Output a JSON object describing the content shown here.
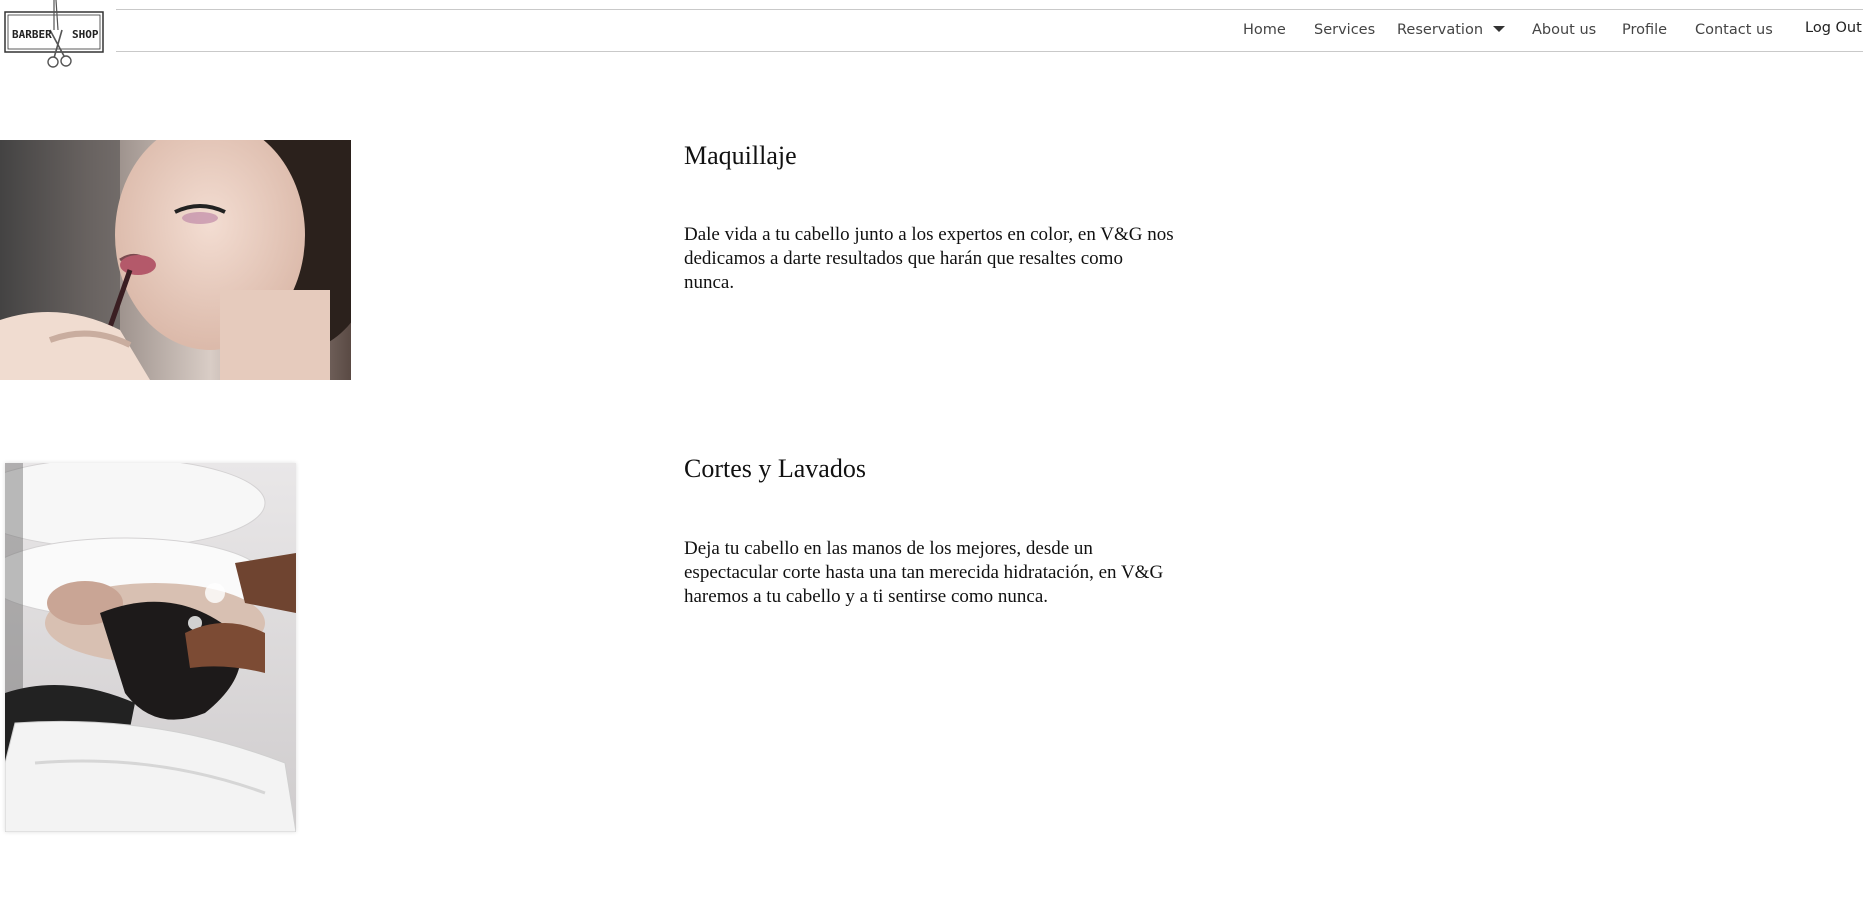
{
  "logo": {
    "text_left": "BARBER",
    "text_right": "SHOP"
  },
  "nav": {
    "home": "Home",
    "services": "Services",
    "reservation": "Reservation",
    "about": "About us",
    "profile": "Profile",
    "contact": "Contact us",
    "logout": "Log Out"
  },
  "services": [
    {
      "title": "Maquillaje",
      "description": "Dale vida a tu cabello junto a los expertos en color, en V&G nos dedicamos a darte resultados que harán que resaltes como nunca.",
      "image_icon": "makeup-photo"
    },
    {
      "title": "Cortes y Lavados",
      "description": "Deja tu cabello en las manos de los mejores, desde un espectacular corte hasta una tan merecida hidratación, en V&G haremos a tu cabello y a ti sentirse como nunca.",
      "image_icon": "hair-wash-photo"
    }
  ]
}
